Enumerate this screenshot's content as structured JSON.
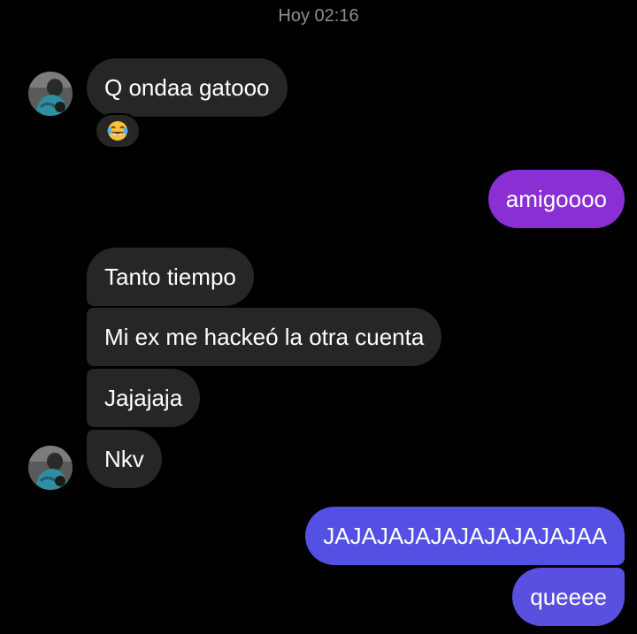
{
  "header": {
    "timestamp": "Hoy 02:16"
  },
  "colors": {
    "background": "#000000",
    "incoming_bubble": "#262626",
    "outgoing_purple": "#8a2fd4",
    "outgoing_blue": "#5b4fe0",
    "text": "#ffffff",
    "timestamp": "#8e8e8e"
  },
  "messages": [
    {
      "id": "m1",
      "direction": "incoming",
      "text": "Q ondaa gatooo"
    },
    {
      "id": "m2",
      "direction": "outgoing",
      "text": "amigoooo"
    },
    {
      "id": "m3",
      "direction": "incoming",
      "text": "Tanto tiempo"
    },
    {
      "id": "m4",
      "direction": "incoming",
      "text": "Mi ex me hackeó la otra cuenta"
    },
    {
      "id": "m5",
      "direction": "incoming",
      "text": "Jajajaja"
    },
    {
      "id": "m6",
      "direction": "incoming",
      "text": "Nkv"
    },
    {
      "id": "m7",
      "direction": "outgoing",
      "text": "JAJAJAJAJAJAJAJAJAJAA"
    },
    {
      "id": "m8",
      "direction": "outgoing",
      "text": "queeee"
    }
  ],
  "reactions": [
    {
      "message": "m1",
      "icon": "laughing-tears-emoji"
    }
  ],
  "avatars": [
    {
      "icon": "contact-avatar"
    }
  ]
}
